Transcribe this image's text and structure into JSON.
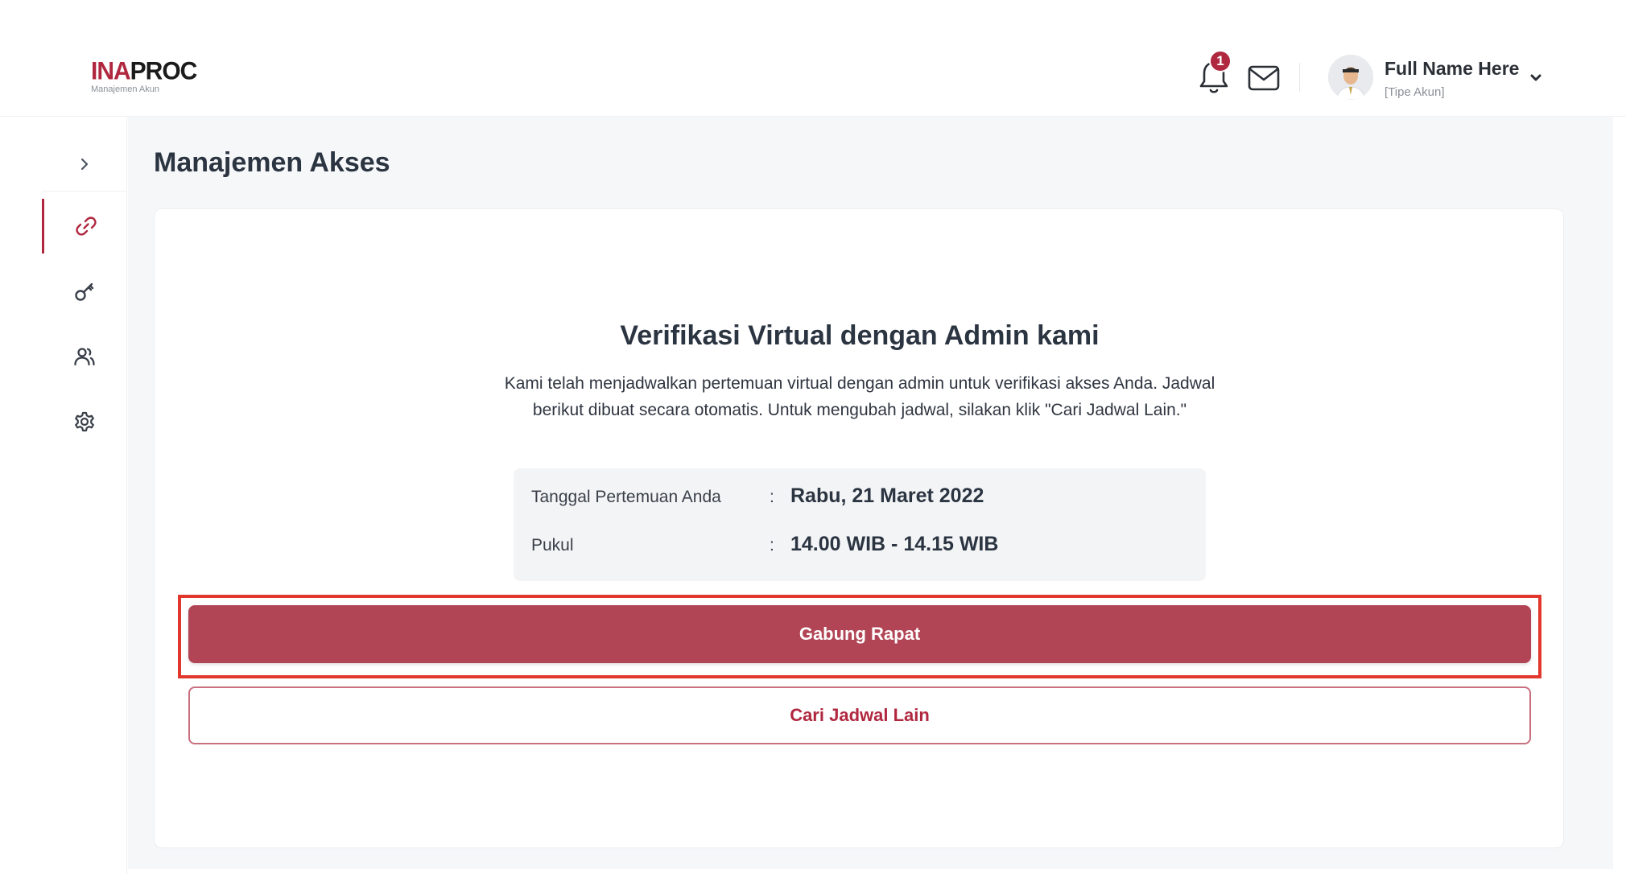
{
  "header": {
    "logo": {
      "main_red": "INA",
      "main_dark": "PROC",
      "subtitle": "Manajemen Akun"
    },
    "notifications": {
      "count": "1",
      "icon": "bell-icon"
    },
    "messages": {
      "icon": "mail-icon"
    },
    "user": {
      "name": "Full Name Here",
      "type": "[Tipe Akun]",
      "icon": "chevron-down-icon"
    }
  },
  "sidebar": {
    "toggle_icon": "chevron-right-icon",
    "items": [
      {
        "icon": "link-icon",
        "active": true
      },
      {
        "icon": "key-icon",
        "active": false
      },
      {
        "icon": "users-icon",
        "active": false
      },
      {
        "icon": "gear-icon",
        "active": false
      }
    ]
  },
  "main": {
    "page_title": "Manajemen Akses",
    "card": {
      "title": "Verifikasi Virtual dengan Admin kami",
      "description": "Kami telah menjadwalkan pertemuan virtual dengan admin untuk verifikasi akses Anda. Jadwal berikut dibuat secara otomatis. Untuk mengubah jadwal, silakan klik \"Cari Jadwal Lain.\"",
      "schedule": {
        "date_label": "Tanggal Pertemuan Anda",
        "date_value": "Rabu, 21 Maret 2022",
        "time_label": "Pukul",
        "time_value": "14.00 WIB - 14.15 WIB",
        "separator": ":"
      },
      "join_button": "Gabung Rapat",
      "reschedule_button": "Cari Jadwal Lain"
    }
  },
  "colors": {
    "brand": "#b0283f",
    "primary_button": "#b24555",
    "highlight": "#e1372c",
    "background": "#f6f7f9"
  }
}
